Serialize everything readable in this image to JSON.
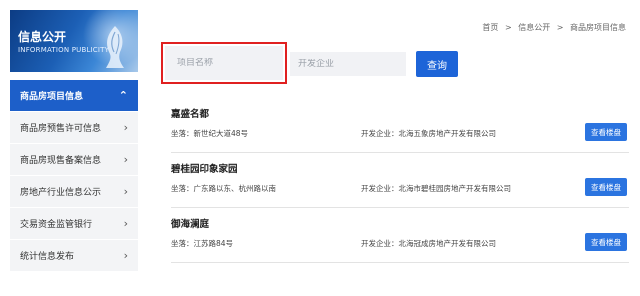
{
  "banner": {
    "title": "信息公开",
    "subtitle": "INFORMATION PUBLICITY"
  },
  "sidebar": {
    "items": [
      {
        "label": "商品房项目信息",
        "active": true,
        "icon": "chevron-up-icon"
      },
      {
        "label": "商品房预售许可信息",
        "active": false,
        "icon": "chevron-right-icon"
      },
      {
        "label": "商品房现售备案信息",
        "active": false,
        "icon": "chevron-right-icon"
      },
      {
        "label": "房地产行业信息公示",
        "active": false,
        "icon": "chevron-right-icon"
      },
      {
        "label": "交易资金监管银行",
        "active": false,
        "icon": "chevron-right-icon"
      },
      {
        "label": "统计信息发布",
        "active": false,
        "icon": "chevron-right-icon"
      }
    ]
  },
  "breadcrumb": {
    "items": [
      "首页",
      "信息公开",
      "商品房项目信息"
    ],
    "separator": ">"
  },
  "search": {
    "name_placeholder": "项目名称",
    "developer_placeholder": "开发企业",
    "button_label": "查询"
  },
  "results": [
    {
      "name": "嘉盛名都",
      "address": "坐落：新世纪大道48号",
      "developer": "开发企业：北海五象房地产开发有限公司",
      "button": "查看楼盘"
    },
    {
      "name": "碧桂园印象家园",
      "address": "坐落：广东路以东、杭州路以南",
      "developer": "开发企业：北海市碧桂园房地产开发有限公司",
      "button": "查看楼盘"
    },
    {
      "name": "御海澜庭",
      "address": "坐落：江苏路84号",
      "developer": "开发企业：北海冠成房地产开发有限公司",
      "button": "查看楼盘"
    }
  ],
  "colors": {
    "primary": "#1d5fc9",
    "highlight_border": "#e02020"
  }
}
